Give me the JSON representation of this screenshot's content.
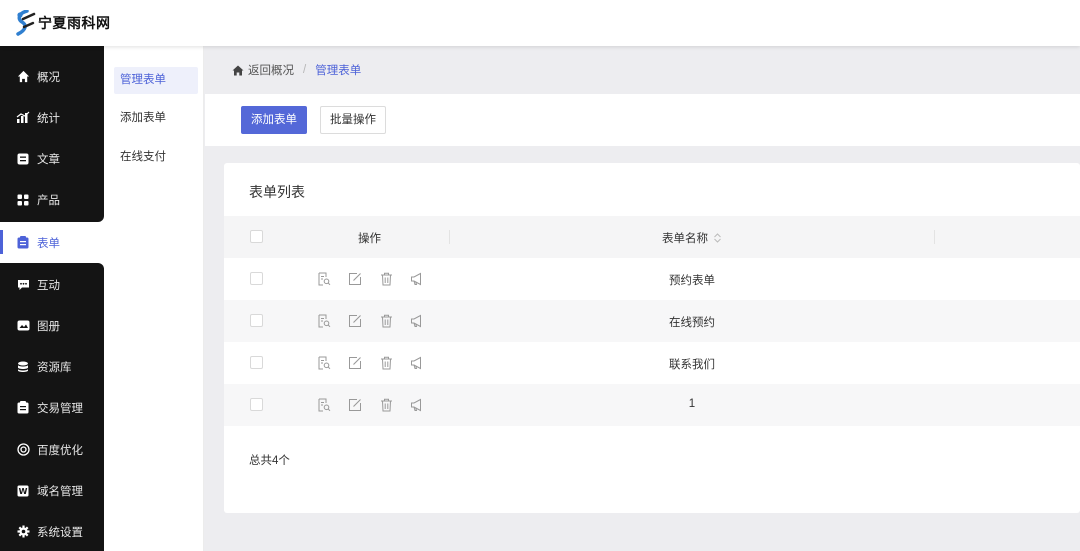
{
  "header": {
    "brand": "宁夏雨科网"
  },
  "sidebar": {
    "items": [
      {
        "label": "概况",
        "icon": "home-icon"
      },
      {
        "label": "统计",
        "icon": "stats-icon"
      },
      {
        "label": "文章",
        "icon": "article-icon"
      },
      {
        "label": "产品",
        "icon": "product-icon"
      },
      {
        "label": "表单",
        "icon": "form-icon",
        "active": true
      },
      {
        "label": "互动",
        "icon": "chat-icon"
      },
      {
        "label": "图册",
        "icon": "album-icon"
      },
      {
        "label": "资源库",
        "icon": "database-icon"
      },
      {
        "label": "交易管理",
        "icon": "trade-icon"
      },
      {
        "label": "百度优化",
        "icon": "seo-icon"
      },
      {
        "label": "域名管理",
        "icon": "domain-icon"
      },
      {
        "label": "系统设置",
        "icon": "gear-icon"
      }
    ]
  },
  "subnav": {
    "items": [
      {
        "label": "管理表单",
        "active": true
      },
      {
        "label": "添加表单"
      },
      {
        "label": "在线支付"
      }
    ]
  },
  "breadcrumb": {
    "back": "返回概况",
    "separator": "/",
    "current": "管理表单"
  },
  "toolbar": {
    "add_label": "添加表单",
    "batch_label": "批量操作"
  },
  "table": {
    "title": "表单列表",
    "columns": {
      "op": "操作",
      "name": "表单名称"
    },
    "rows": [
      {
        "name": "预约表单"
      },
      {
        "name": "在线预约"
      },
      {
        "name": "联系我们"
      },
      {
        "name": "1"
      }
    ],
    "total": "总共4个"
  },
  "colors": {
    "accent": "#5468d8",
    "sidebar_bg": "#141414",
    "page_bg": "#ededf0"
  }
}
